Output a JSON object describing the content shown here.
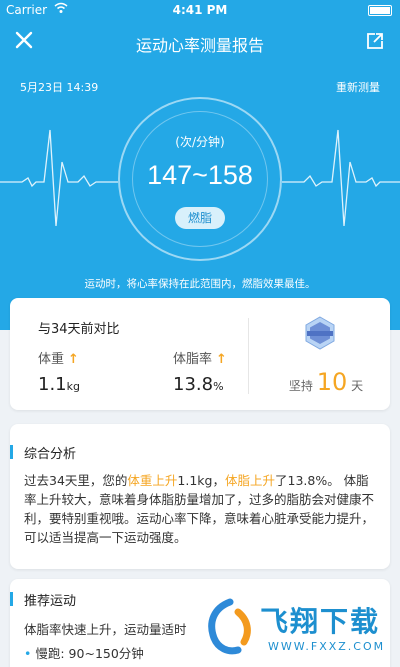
{
  "status_bar": {
    "carrier": "Carrier",
    "time": "4:41 PM"
  },
  "nav": {
    "title": "运动心率测量报告",
    "close_icon": "close-icon",
    "share_icon": "share-icon"
  },
  "measurement": {
    "date": "5月23日 14:39",
    "remeasure_label": "重新测量",
    "unit": "(次/分钟)",
    "range": "147~158",
    "zone": "燃脂",
    "tip": "运动时，将心率保持在此范围内，燃脂效果最佳。"
  },
  "comparison": {
    "title": "与34天前对比",
    "weight": {
      "label": "体重",
      "value": "1.1",
      "unit": "kg",
      "trend": "↑"
    },
    "body_fat": {
      "label": "体脂率",
      "value": "13.8",
      "unit": "%",
      "trend": "↑"
    },
    "persist": {
      "prefix": "坚持",
      "days": "10",
      "suffix": "天"
    }
  },
  "analysis": {
    "title": "综合分析",
    "p1": "过去34天里，您的",
    "h1": "体重上升",
    "p2": "1.1kg，",
    "h2": "体脂上升",
    "p3": "了13.8%。 体脂率上升较大，意味着身体脂肪量增加了，过多的脂肪会对健康不利，要特别重视哦。运动心率下降，意味着心脏承受能力提升，可以适当提高一下运动强度。"
  },
  "recommend": {
    "title": "推荐运动",
    "text": "体脂率快速上升，运动量适时",
    "items": [
      "慢跑: 90~150分钟"
    ]
  },
  "colors": {
    "primary": "#24a8e6",
    "accent": "#f5a623",
    "background": "#eef2f6"
  }
}
